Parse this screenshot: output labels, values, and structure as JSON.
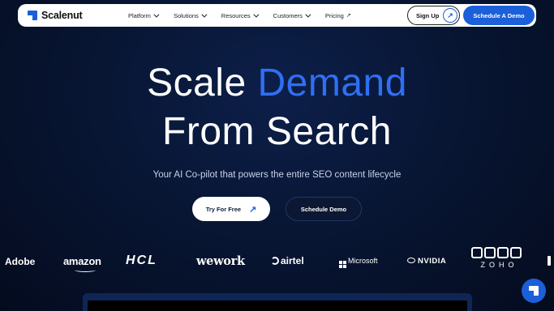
{
  "brand": {
    "name": "Scalenut",
    "accent": "#1b5fd9"
  },
  "nav": {
    "items": [
      {
        "label": "Platform",
        "icon": "chevron-down-icon"
      },
      {
        "label": "Solutions",
        "icon": "chevron-down-icon"
      },
      {
        "label": "Resources",
        "icon": "chevron-down-icon"
      },
      {
        "label": "Customers",
        "icon": "chevron-down-icon"
      },
      {
        "label": "Pricing",
        "icon": "arrow-up-right-icon"
      }
    ],
    "signup_label": "Sign Up",
    "demo_label": "Schedule A Demo"
  },
  "hero": {
    "line1_plain": "Scale",
    "line1_accent": "Demand",
    "line2": "From Search",
    "subtitle": "Your AI Co-pilot that powers the entire SEO content lifecycle",
    "cta_primary": "Try For Free",
    "cta_secondary": "Schedule Demo",
    "accent_color": "#2f6ff2"
  },
  "logos": [
    "Adobe",
    "amazon",
    "HCL",
    "wework",
    "airtel",
    "Microsoft",
    "NVIDIA",
    "ZOHO"
  ],
  "arrow_glyph": "↗"
}
